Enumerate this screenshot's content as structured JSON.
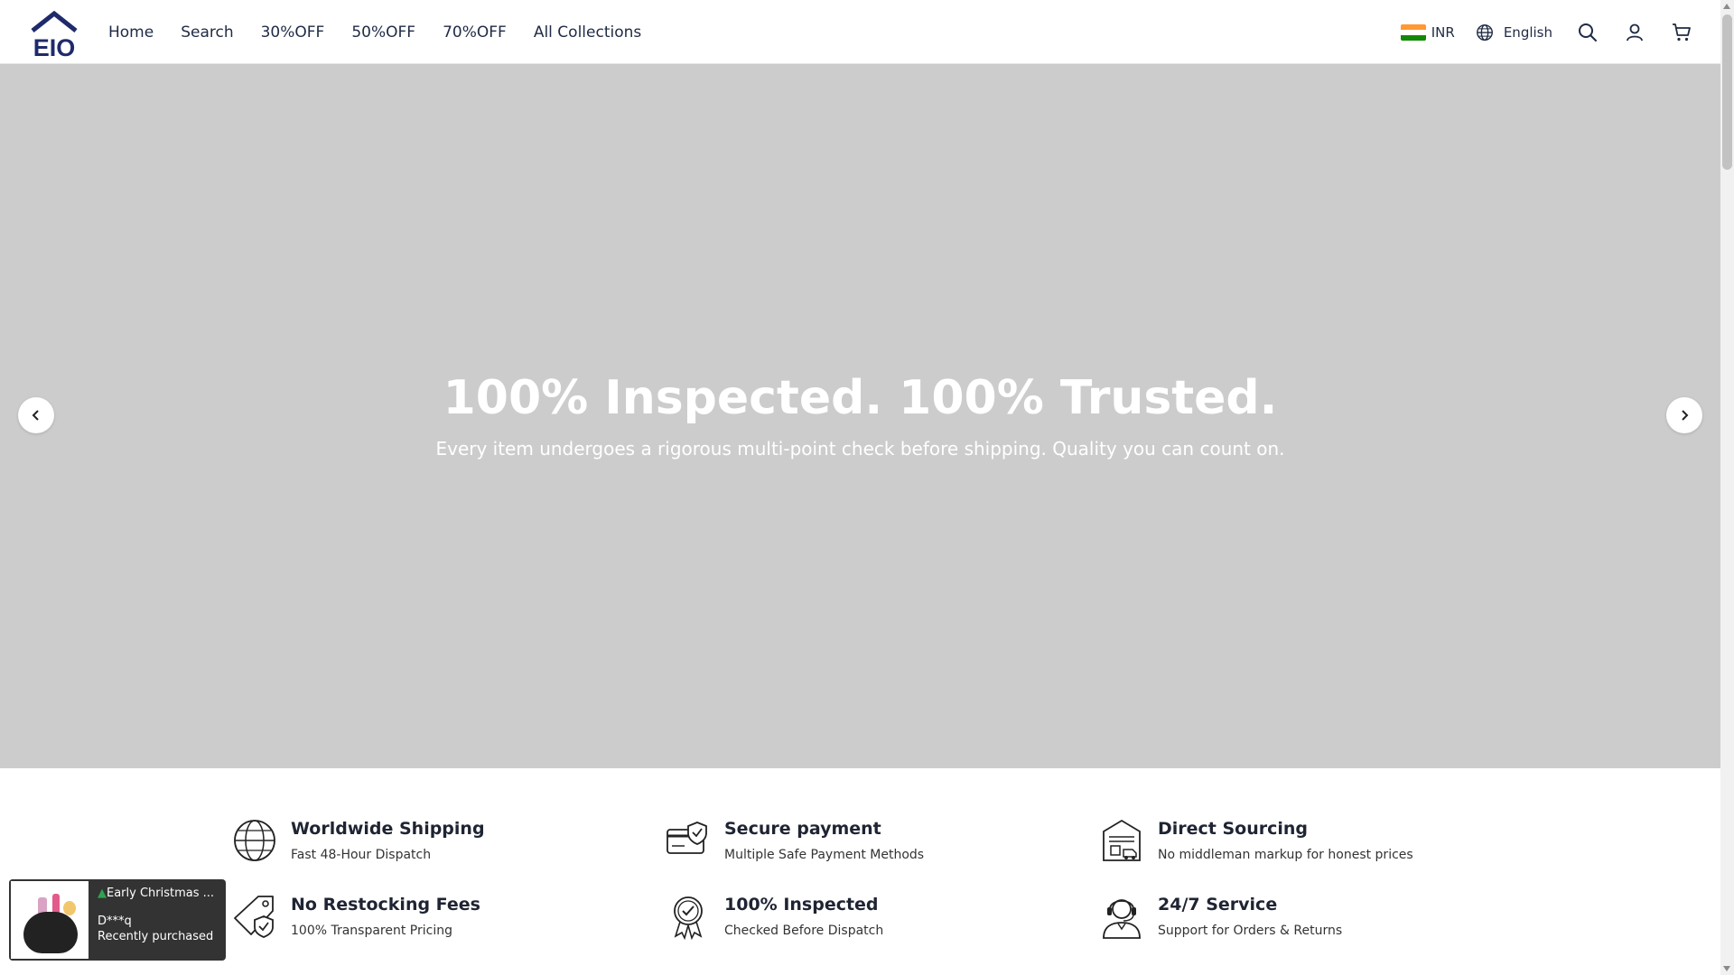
{
  "header": {
    "logo_text": "EIO",
    "nav": [
      "Home",
      "Search",
      "30%OFF",
      "50%OFF",
      "70%OFF",
      "All Collections"
    ],
    "currency": "INR",
    "language": "English"
  },
  "hero": {
    "title": "100% Inspected. 100% Trusted.",
    "subtitle": "Every item undergoes a rigorous multi-point check before shipping. Quality you can count on."
  },
  "features": [
    {
      "title": "Worldwide Shipping",
      "subtitle": "Fast 48-Hour Dispatch",
      "icon": "globe-icon"
    },
    {
      "title": "Secure payment",
      "subtitle": "Multiple Safe Payment Methods",
      "icon": "card-shield-icon"
    },
    {
      "title": "Direct Sourcing",
      "subtitle": "No middleman markup for honest prices",
      "icon": "warehouse-icon"
    },
    {
      "title": "No Restocking Fees",
      "subtitle": "100% Transparent Pricing",
      "icon": "price-tag-check-icon"
    },
    {
      "title": "100% Inspected",
      "subtitle": "Checked Before Dispatch",
      "icon": "badge-check-icon"
    },
    {
      "title": "24/7 Service",
      "subtitle": "Support for Orders & Returns",
      "icon": "support-agent-icon"
    }
  ],
  "popup": {
    "title": "Early Christmas ...",
    "customer": "D***q",
    "status": "Recently purchased"
  },
  "colors": {
    "hero_bg": "#cccccc",
    "nav_text": "#1f2a44",
    "logo": "#1f2a6b",
    "popup_bg": "#333333"
  }
}
